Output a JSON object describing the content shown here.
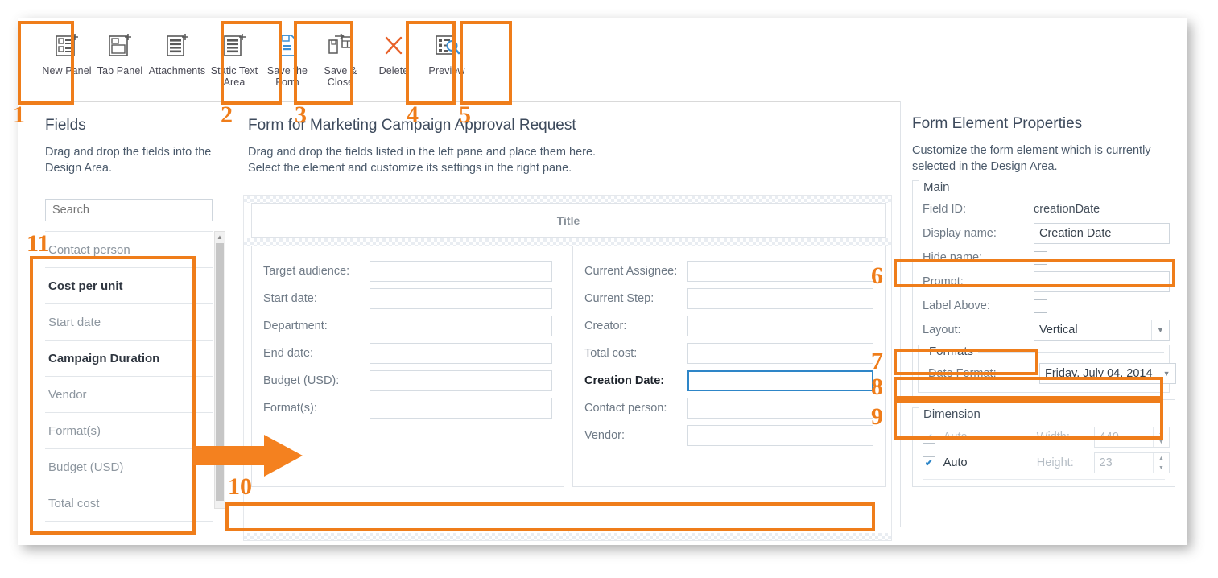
{
  "toolbar": {
    "buttons": [
      {
        "label": "New Panel",
        "icon": "new-panel-icon",
        "highlighted": true
      },
      {
        "label": "Tab Panel",
        "icon": "tab-panel-icon",
        "highlighted": false
      },
      {
        "label": "Attachments",
        "icon": "attachments-icon",
        "highlighted": false
      },
      {
        "label": "Static Text Area",
        "icon": "static-text-area-icon",
        "highlighted": true
      },
      {
        "label": "Save the Form",
        "icon": "save-form-icon",
        "highlighted": true
      },
      {
        "label": "Save & Close",
        "icon": "save-and-close-icon",
        "highlighted": false
      },
      {
        "label": "Delete",
        "icon": "delete-icon",
        "highlighted": true
      },
      {
        "label": "Preview",
        "icon": "preview-icon",
        "highlighted": true
      }
    ]
  },
  "left_pane": {
    "title": "Fields",
    "subtitle": "Drag and drop the fields into the Design Area.",
    "search_placeholder": "Search",
    "fields": [
      {
        "label": "Contact person",
        "used": false
      },
      {
        "label": "Cost per unit",
        "used": true
      },
      {
        "label": "Start date",
        "used": false
      },
      {
        "label": "Campaign Duration",
        "used": true
      },
      {
        "label": "Vendor",
        "used": false
      },
      {
        "label": "Format(s)",
        "used": false
      },
      {
        "label": "Budget (USD)",
        "used": false
      },
      {
        "label": "Total cost",
        "used": false
      }
    ]
  },
  "center_pane": {
    "title": "Form for Marketing Campaign Approval Request",
    "subtitle_line1": "Drag and drop the fields listed in the left pane and place them here.",
    "subtitle_line2": "Select the element and customize its settings in the right pane.",
    "design_title_placeholder": "Title",
    "left_column_fields": [
      {
        "label": "Target audience:",
        "value": "",
        "selected": false
      },
      {
        "label": "Start date:",
        "value": "",
        "selected": false
      },
      {
        "label": "Department:",
        "value": "",
        "selected": false
      },
      {
        "label": "End date:",
        "value": "",
        "selected": false
      },
      {
        "label": "Budget (USD):",
        "value": "",
        "selected": false
      },
      {
        "label": "Format(s):",
        "value": "",
        "selected": false
      }
    ],
    "right_column_fields": [
      {
        "label": "Current Assignee:",
        "value": "",
        "selected": false
      },
      {
        "label": "Current Step:",
        "value": "",
        "selected": false
      },
      {
        "label": "Creator:",
        "value": "",
        "selected": false
      },
      {
        "label": "Total cost:",
        "value": "",
        "selected": false
      },
      {
        "label": "Creation Date:",
        "value": "",
        "selected": true
      },
      {
        "label": "Contact person:",
        "value": "",
        "selected": false
      },
      {
        "label": "Vendor:",
        "value": "",
        "selected": false
      }
    ]
  },
  "right_pane": {
    "title": "Form Element Properties",
    "subtitle": "Customize the form element which is currently selected in the Design Area.",
    "main_group": {
      "title": "Main",
      "field_id_label": "Field ID:",
      "field_id_value": "creationDate",
      "display_name_label": "Display name:",
      "display_name_value": "Creation Date",
      "hide_name_label": "Hide name:",
      "hide_name_checked": false,
      "prompt_label": "Prompt:",
      "prompt_value": "",
      "label_above_label": "Label Above:",
      "label_above_checked": false,
      "layout_label": "Layout:",
      "layout_value": "Vertical"
    },
    "formats_group": {
      "title": "Formats",
      "date_format_label": "Date Format:",
      "date_format_value": "Friday, July 04, 2014"
    },
    "dimension_group": {
      "title": "Dimension",
      "width_auto_label": "Auto",
      "width_auto_checked": true,
      "width_label": "Width:",
      "width_value": "440",
      "height_auto_label": "Auto",
      "height_auto_checked": true,
      "height_label": "Height:",
      "height_value": "23"
    }
  },
  "annotations": {
    "accent_color": "#ef7d1a",
    "numbers": [
      "1",
      "2",
      "3",
      "4",
      "5",
      "6",
      "7",
      "8",
      "9",
      "10",
      "11"
    ]
  }
}
